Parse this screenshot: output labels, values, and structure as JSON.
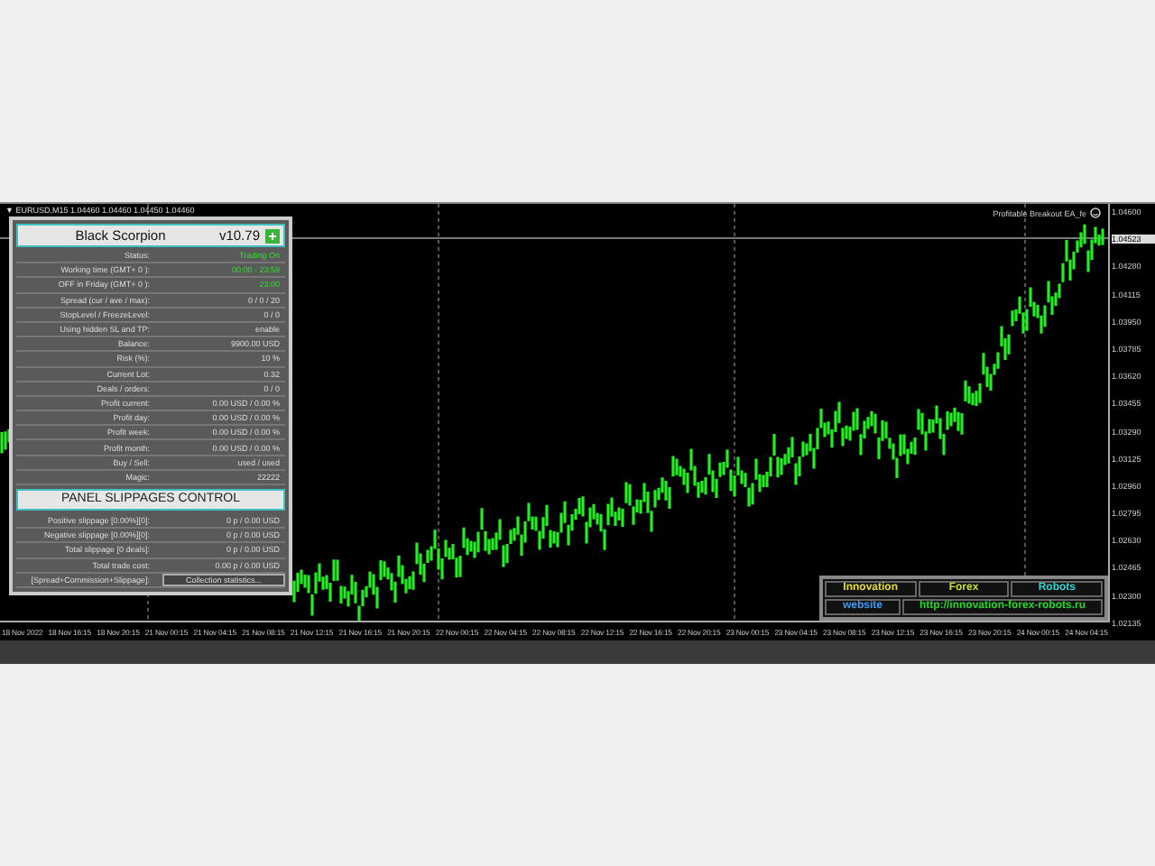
{
  "chart": {
    "header": "▼ EURUSD,M15 1.04460 1.04460 1.04450 1.04460",
    "ea_label": "Profitable Breakout EA_fe",
    "current_price": "1.04523",
    "price_labels": [
      "1.04600",
      "1.04280",
      "1.04115",
      "1.03950",
      "1.03785",
      "1.03620",
      "1.03455",
      "1.03290",
      "1.03125",
      "1.02960",
      "1.02795",
      "1.02630",
      "1.02465",
      "1.02300",
      "1.02135"
    ],
    "time_labels": [
      "18 Nov 2022",
      "18 Nov 16:15",
      "18 Nov 20:15",
      "21 Nov 00:15",
      "21 Nov 04:15",
      "21 Nov 08:15",
      "21 Nov 12:15",
      "21 Nov 16:15",
      "21 Nov 20:15",
      "22 Nov 00:15",
      "22 Nov 04:15",
      "22 Nov 08:15",
      "22 Nov 12:15",
      "22 Nov 16:15",
      "22 Nov 20:15",
      "23 Nov 00:15",
      "23 Nov 04:15",
      "23 Nov 08:15",
      "23 Nov 12:15",
      "23 Nov 16:15",
      "23 Nov 20:15",
      "24 Nov 00:15",
      "24 Nov 04:15"
    ]
  },
  "panel": {
    "title": "Black Scorpion",
    "version": "v10.79",
    "rows": [
      {
        "label": "Status:",
        "value": "Trading On",
        "highlight": true
      },
      {
        "label": "Working time (GMT+ 0 ):",
        "value": "00:00 - 23:59",
        "highlight": true
      },
      {
        "label": "OFF in Friday (GMT+ 0 ):",
        "value": "23:00",
        "highlight": true
      },
      {
        "label": "Spread (cur / ave / max):",
        "value": "0 / 0 / 20",
        "highlight": false
      },
      {
        "label": "StopLevel  /  FreezeLevel:",
        "value": "0  /  0",
        "highlight": false
      },
      {
        "label": "Using hidden SL and TP:",
        "value": "enable",
        "highlight": false
      },
      {
        "label": "Balance:",
        "value": "9900.00 USD",
        "highlight": false
      },
      {
        "label": "Risk (%):",
        "value": "10 %",
        "highlight": false
      },
      {
        "label": "Current Lot:",
        "value": "0.32",
        "highlight": false
      },
      {
        "label": "Deals / orders:",
        "value": "0  /  0",
        "highlight": false
      },
      {
        "label": "Profit current:",
        "value": "0.00 USD / 0.00 %",
        "highlight": false
      },
      {
        "label": "Profit day:",
        "value": "0.00 USD / 0.00 %",
        "highlight": false
      },
      {
        "label": "Profit week:",
        "value": "0.00 USD / 0.00 %",
        "highlight": false
      },
      {
        "label": "Profit month:",
        "value": "0.00 USD / 0.00 %",
        "highlight": false
      },
      {
        "label": "Buy / Sell:",
        "value": "used  /  used",
        "highlight": false
      },
      {
        "label": "Magic:",
        "value": "22222",
        "highlight": false
      }
    ],
    "section_title": "PANEL SLIPPAGES CONTROL",
    "slippage_rows": [
      {
        "label": "Positive slippage [0.00%][0]:",
        "value": "0 p / 0.00 USD"
      },
      {
        "label": "Negative slippage [0.00%][0]:",
        "value": "0 p / 0.00 USD"
      },
      {
        "label": "Total slippage [0 deals]:",
        "value": "0 p / 0.00 USD"
      },
      {
        "label": "Total trade cost:",
        "value": "0.00 p / 0.00 USD"
      }
    ],
    "footer_label": "[Spread+Commission+Slippage]:",
    "button": "Collection statistics..."
  },
  "links": {
    "items": [
      {
        "text": "Innovation",
        "color": "#e8e030"
      },
      {
        "text": "Forex",
        "color": "#c8e030"
      },
      {
        "text": "Robots",
        "color": "#30d8d8"
      }
    ],
    "website_label": "website",
    "url": "http://innovation-forex-robots.ru"
  }
}
